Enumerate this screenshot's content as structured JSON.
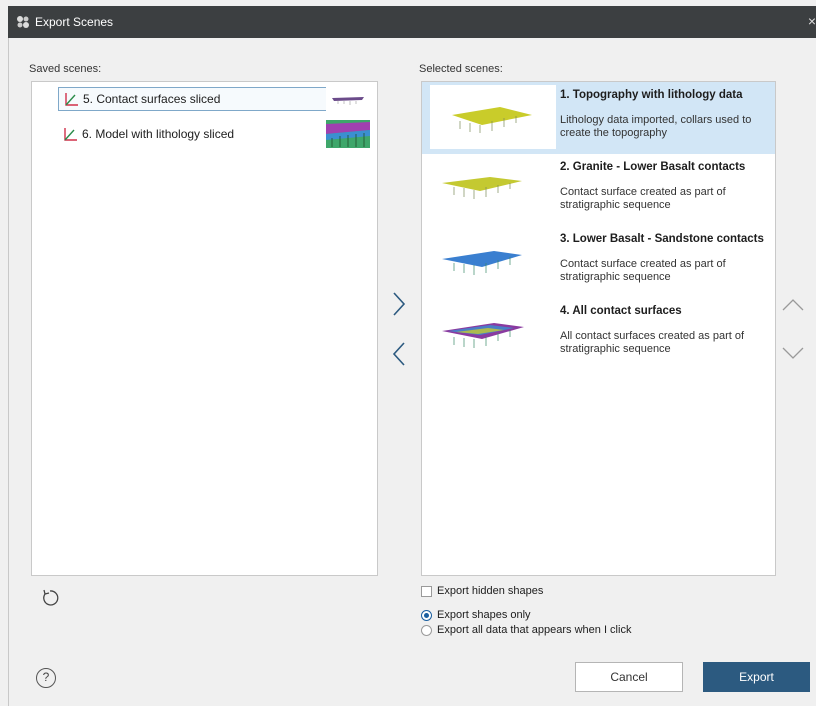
{
  "window": {
    "title": "Export Scenes",
    "close": "×"
  },
  "saved": {
    "label": "Saved scenes:",
    "items": [
      {
        "label": "5. Contact surfaces sliced"
      },
      {
        "label": "6. Model with lithology sliced"
      }
    ]
  },
  "selected": {
    "label": "Selected scenes:",
    "items": [
      {
        "name": "1. Topography with lithology data",
        "desc": "Lithology data imported, collars used to create the topography"
      },
      {
        "name": "2. Granite - Lower Basalt contacts",
        "desc": "Contact surface created as part of stratigraphic sequence"
      },
      {
        "name": "3. Lower Basalt - Sandstone contacts",
        "desc": "Contact surface created as part of stratigraphic sequence"
      },
      {
        "name": "4. All contact surfaces",
        "desc": "All contact surfaces created as part of stratigraphic sequence"
      }
    ]
  },
  "options": {
    "hidden_shapes": "Export hidden shapes",
    "shapes_only": "Export shapes only",
    "all_data": "Export all data that appears when I click"
  },
  "buttons": {
    "cancel": "Cancel",
    "export": "Export",
    "help": "?"
  },
  "colors": {
    "accent": "#2c5a80",
    "selection": "#d2e6f6",
    "titlebar": "#3c3f41"
  }
}
